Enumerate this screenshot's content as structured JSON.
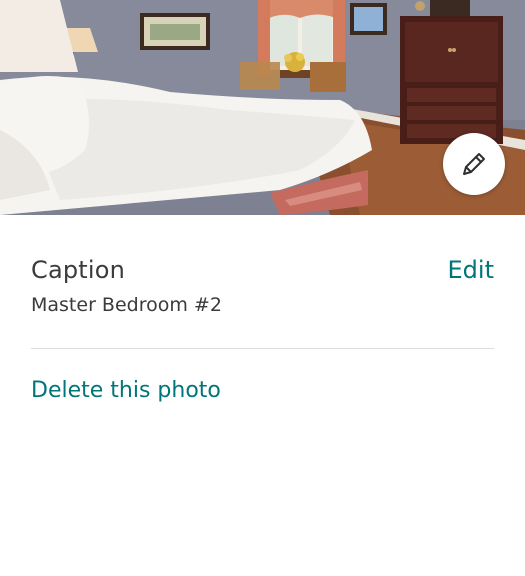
{
  "photo": {
    "alt_subject": "bedroom photo",
    "edit_icon": "pencil-icon"
  },
  "caption": {
    "title": "Caption",
    "edit_label": "Edit",
    "value": "Master Bedroom #2"
  },
  "actions": {
    "delete_label": "Delete this photo"
  },
  "colors": {
    "accent": "#00757a",
    "text": "#3b3b3b",
    "divider": "#dddddd"
  }
}
